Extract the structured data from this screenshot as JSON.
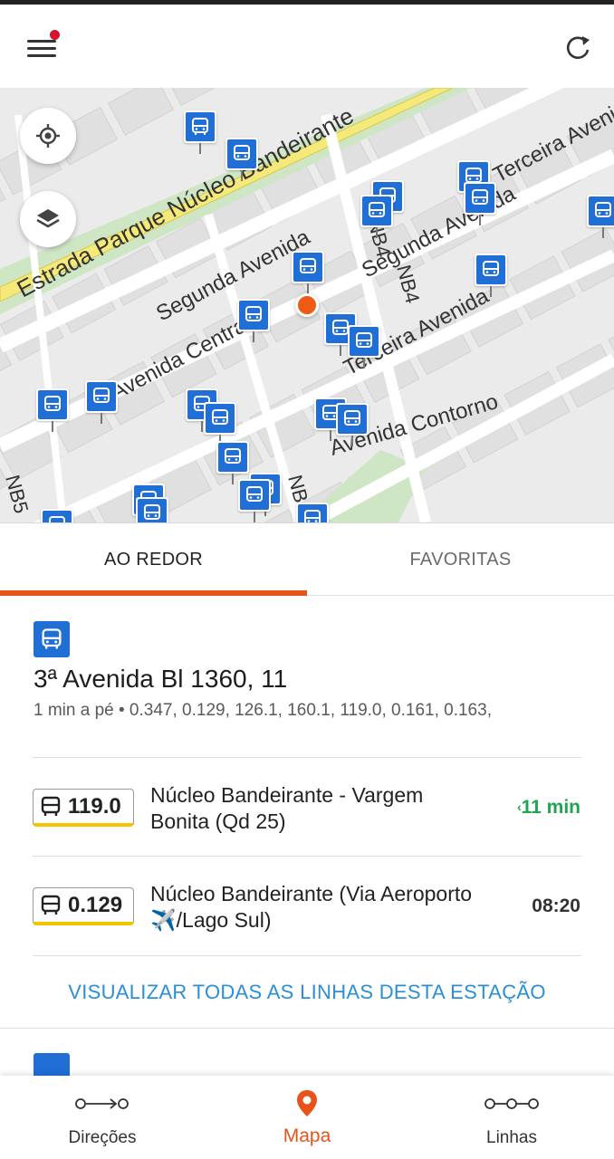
{
  "app": {
    "accent_color": "#e8531a",
    "stop_color": "#1f6fd6",
    "live_color": "#1ea550"
  },
  "header": {
    "menu_icon": "hamburger-menu-icon",
    "refresh_icon": "refresh-icon"
  },
  "map": {
    "street_labels": [
      "Estrada Parque Núcleo Bandeirante",
      "Segunda Avenida",
      "Segunda Avenida",
      "Avenida Central",
      "Terceira Avenida",
      "Terceira Avenida",
      "Avenida Contorno",
      "NB4",
      "NB4",
      "NB5",
      "NB"
    ]
  },
  "tabs": [
    {
      "label": "AO REDOR",
      "active": true
    },
    {
      "label": "FAVORITAS",
      "active": false
    }
  ],
  "station": {
    "name": "3ª Avenida Bl 1360, 11",
    "meta": "1 min a pé • 0.347, 0.129, 126.1, 160.1, 119.0, 0.161, 0.163,"
  },
  "lines": [
    {
      "route": "119.0",
      "name": "Núcleo Bandeirante - Vargem Bonita (Qd 25)",
      "time": "11 min",
      "live": true
    },
    {
      "route": "0.129",
      "name": "Núcleo Bandeirante (Via Aeroporto ✈️/Lago Sul)",
      "time": "08:20",
      "live": false
    }
  ],
  "view_all_label": "VISUALIZAR TODAS AS LINHAS DESTA ESTAÇÃO",
  "bottom_nav": [
    {
      "label": "Direções",
      "icon": "directions-icon",
      "active": false
    },
    {
      "label": "Mapa",
      "icon": "map-pin-icon",
      "active": true
    },
    {
      "label": "Linhas",
      "icon": "lines-icon",
      "active": false
    }
  ]
}
